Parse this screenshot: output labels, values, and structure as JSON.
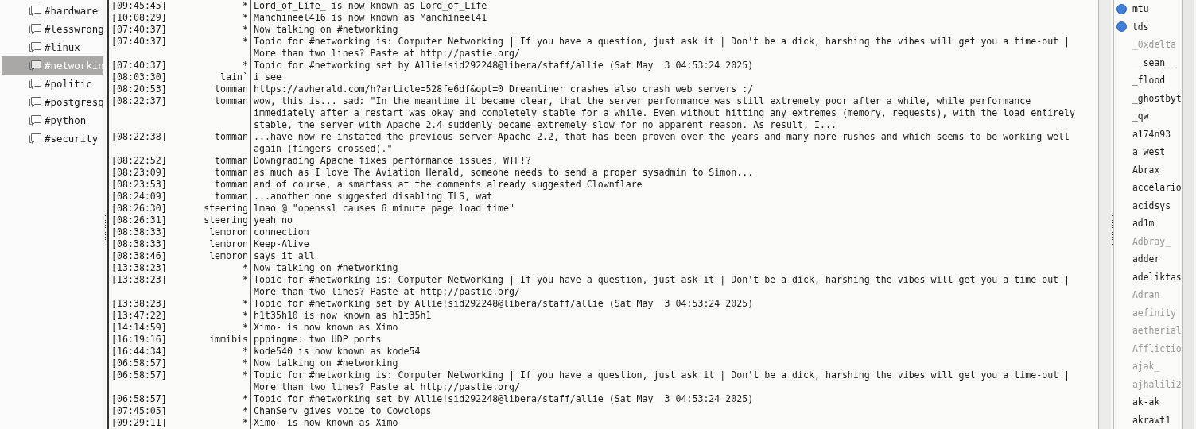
{
  "channels": [
    {
      "name": "#hardware",
      "selected": false
    },
    {
      "name": "#lesswrong",
      "selected": false
    },
    {
      "name": "#linux",
      "selected": false
    },
    {
      "name": "#networkin",
      "selected": true
    },
    {
      "name": "#politic",
      "selected": false
    },
    {
      "name": "#postgresq",
      "selected": false
    },
    {
      "name": "#python",
      "selected": false
    },
    {
      "name": "#security",
      "selected": false
    }
  ],
  "messages": [
    {
      "time": "[09:45:45]",
      "nick": "*",
      "lines": [
        "Lord_of_Life_ is now known as Lord_of_Life"
      ]
    },
    {
      "time": "[10:08:29]",
      "nick": "*",
      "lines": [
        "Manchineel416 is now known as Manchineel41"
      ]
    },
    {
      "time": "[07:40:37]",
      "nick": "*",
      "lines": [
        "Now talking on #networking"
      ]
    },
    {
      "time": "[07:40:37]",
      "nick": "*",
      "lines": [
        "Topic for #networking is: Computer Networking | If you have a question, just ask it | Don't be a dick, harshing the vibes will get you a time-out |",
        "More than two lines? Paste at http://pastie.org/"
      ]
    },
    {
      "time": "[07:40:37]",
      "nick": "*",
      "lines": [
        "Topic for #networking set by Allie!sid292248@libera/staff/allie (Sat May  3 04:53:24 2025)"
      ]
    },
    {
      "time": "[08:03:30]",
      "nick": "lain`",
      "lines": [
        "i see"
      ]
    },
    {
      "time": "[08:20:53]",
      "nick": "tomman",
      "lines": [
        "https://avherald.com/h?article=528fe6df&opt=0 Dreamliner crashes also crash web servers :/"
      ]
    },
    {
      "time": "[08:22:37]",
      "nick": "tomman",
      "lines": [
        "wow, this is... sad: \"In the meantime it became clear, that the server performance was still extremely poor after a while, while performance",
        "immediately after a restart was okay and completely stable for a while. Even without hitting any extremes (memory, requests), with the load entirely",
        "stable, the server with Apache 2.4 suddenly became extremely slow for no apparent reason. As result, I..."
      ]
    },
    {
      "time": "[08:22:38]",
      "nick": "tomman",
      "lines": [
        "...have now re-instated the previous server Apache 2.2, that has been proven over the years and many more rushes and which seems to be working well",
        "again (fingers crossed).\""
      ]
    },
    {
      "time": "[08:22:52]",
      "nick": "tomman",
      "lines": [
        "Downgrading Apache fixes performance issues, WTF!?"
      ]
    },
    {
      "time": "[08:23:09]",
      "nick": "tomman",
      "lines": [
        "as much as I love The Aviation Herald, someone needs to send a proper sysadmin to Simon..."
      ]
    },
    {
      "time": "[08:23:53]",
      "nick": "tomman",
      "lines": [
        "and of course, a smartass at the comments already suggested Clownflare"
      ]
    },
    {
      "time": "[08:24:09]",
      "nick": "tomman",
      "lines": [
        "...another one suggested disabling TLS, wat"
      ]
    },
    {
      "time": "[08:26:30]",
      "nick": "steering",
      "lines": [
        "lmao @ \"openssl causes 6 minute page load time\""
      ]
    },
    {
      "time": "[08:26:31]",
      "nick": "steering",
      "lines": [
        "yeah no"
      ]
    },
    {
      "time": "[08:38:33]",
      "nick": "lembron",
      "lines": [
        "connection"
      ]
    },
    {
      "time": "[08:38:33]",
      "nick": "lembron",
      "lines": [
        "Keep-Alive"
      ]
    },
    {
      "time": "[08:38:46]",
      "nick": "lembron",
      "lines": [
        "says it all"
      ]
    },
    {
      "time": "[13:38:23]",
      "nick": "*",
      "lines": [
        "Now talking on #networking"
      ]
    },
    {
      "time": "[13:38:23]",
      "nick": "*",
      "lines": [
        "Topic for #networking is: Computer Networking | If you have a question, just ask it | Don't be a dick, harshing the vibes will get you a time-out |",
        "More than two lines? Paste at http://pastie.org/"
      ]
    },
    {
      "time": "[13:38:23]",
      "nick": "*",
      "lines": [
        "Topic for #networking set by Allie!sid292248@libera/staff/allie (Sat May  3 04:53:24 2025)"
      ]
    },
    {
      "time": "[13:47:22]",
      "nick": "*",
      "lines": [
        "h1t35h10 is now known as h1t35h1"
      ]
    },
    {
      "time": "[14:14:59]",
      "nick": "*",
      "lines": [
        "Ximo- is now known as Ximo"
      ]
    },
    {
      "time": "[16:19:16]",
      "nick": "immibis",
      "lines": [
        "pppingme: two UDP ports"
      ]
    },
    {
      "time": "[16:44:34]",
      "nick": "*",
      "lines": [
        "kode540 is now known as kode54"
      ]
    },
    {
      "time": "[06:58:57]",
      "nick": "*",
      "lines": [
        "Now talking on #networking"
      ]
    },
    {
      "time": "[06:58:57]",
      "nick": "*",
      "lines": [
        "Topic for #networking is: Computer Networking | If you have a question, just ask it | Don't be a dick, harshing the vibes will get you a time-out |",
        "More than two lines? Paste at http://pastie.org/"
      ]
    },
    {
      "time": "[06:58:57]",
      "nick": "*",
      "lines": [
        "Topic for #networking set by Allie!sid292248@libera/staff/allie (Sat May  3 04:53:24 2025)"
      ]
    },
    {
      "time": "[07:45:05]",
      "nick": "*",
      "lines": [
        "ChanServ gives voice to Cowclops"
      ]
    },
    {
      "time": "[09:29:11]",
      "nick": "*",
      "lines": [
        "Ximo- is now known as Ximo"
      ]
    }
  ],
  "users": [
    {
      "name": "mtu",
      "voiced": true,
      "away": false
    },
    {
      "name": "tds",
      "voiced": true,
      "away": false
    },
    {
      "name": "_0xdelta",
      "voiced": false,
      "away": true
    },
    {
      "name": "__sean__",
      "voiced": false,
      "away": false
    },
    {
      "name": "_flood",
      "voiced": false,
      "away": false
    },
    {
      "name": "_ghostbyt",
      "voiced": false,
      "away": false
    },
    {
      "name": "_qw",
      "voiced": false,
      "away": false
    },
    {
      "name": "a174n93",
      "voiced": false,
      "away": false
    },
    {
      "name": "a_west",
      "voiced": false,
      "away": false
    },
    {
      "name": "Abrax",
      "voiced": false,
      "away": false
    },
    {
      "name": "accelario",
      "voiced": false,
      "away": false
    },
    {
      "name": "acidsys",
      "voiced": false,
      "away": false
    },
    {
      "name": "ad1m",
      "voiced": false,
      "away": false
    },
    {
      "name": "Adbray_",
      "voiced": false,
      "away": true
    },
    {
      "name": "adder",
      "voiced": false,
      "away": false
    },
    {
      "name": "adeliktas",
      "voiced": false,
      "away": false
    },
    {
      "name": "Adran",
      "voiced": false,
      "away": true
    },
    {
      "name": "aefinity",
      "voiced": false,
      "away": true
    },
    {
      "name": "aetherial",
      "voiced": false,
      "away": true
    },
    {
      "name": "Afflictio",
      "voiced": false,
      "away": true
    },
    {
      "name": "ajak_",
      "voiced": false,
      "away": true
    },
    {
      "name": "ajhalili2",
      "voiced": false,
      "away": true
    },
    {
      "name": "ak-ak",
      "voiced": false,
      "away": false
    },
    {
      "name": "akrawt1",
      "voiced": false,
      "away": false
    }
  ]
}
